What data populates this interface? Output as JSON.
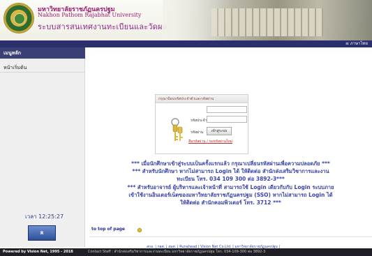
{
  "header": {
    "title_th": "มหาวิทยาลัยราชภัฏนครปฐม",
    "title_en": "Nakhon Pathom Rajabhat University",
    "system_name": "ระบบสารสนเทศงานทะเบียนและวัดผล",
    "lang_link": "≡ ภาษาไทย"
  },
  "sidebar": {
    "menu_title": "เมนูหลัก",
    "items": [
      {
        "label": "หน้าเริ่มต้น"
      }
    ],
    "clock": "เวลา 12:25:27",
    "badge_text": "R"
  },
  "login": {
    "header": "กรุณาป้อนรหัสประจำตัวและรหัสผ่าน",
    "user_label": "รหัสประจำตัว",
    "user_value": "",
    "pass_label": "รหัสผ่าน",
    "pass_value": "",
    "submit": "เข้าสู่ระบบ",
    "forgot": "ลืมรหัสผ่าน / ขอรหัสผ่านใหม่"
  },
  "notices": [
    "*** เมื่อนักศึกษาเข้าสู่ระบบเป็นครั้งแรกแล้ว กรุณาเปลี่ยนรหัสผ่านเพื่อความปลอดภัย ***",
    "*** สำหรับนักศึกษา หากไม่สามารถ Login ได้ ให้ติดต่อ สำนักส่งเสริมวิชาการและงาน",
    "ทะเบียน โทร. 034 109 300 ต่อ 3892-3***",
    "*** สำหรับอาจารย์ ผู้บริหารและเจ้าหน้าที่ สามารถใช้ Login เดียวกับกับ Login ระบบภาย",
    "เข้าใช้งานอินเตอร์เน็ตของมหาวิทยาลัยราชภัฏนครปฐม (SSO) หากไม่สามารถ Login ได้",
    "ให้ติดต่อ สำนักคอมพิวเตอร์ โทร. 3712 ***"
  ],
  "to_top": "to top of page",
  "footer_links": "สกอ. | กยศ. | สมศ. | Runahead | Vision Net Co.Ltd. | มหาวิทยาลัยราชภัฏนครปฐม |",
  "footer": {
    "powered": "Powered by Vision Net, 1995 - 2018",
    "contact": "Contact Staff : สำนักส่งเสริมวิชาการและงานทะเบียน มหาวิทยาลัยราชภัฏนครปฐม โทร. 034-109-300 ต่อ 3892-3"
  }
}
